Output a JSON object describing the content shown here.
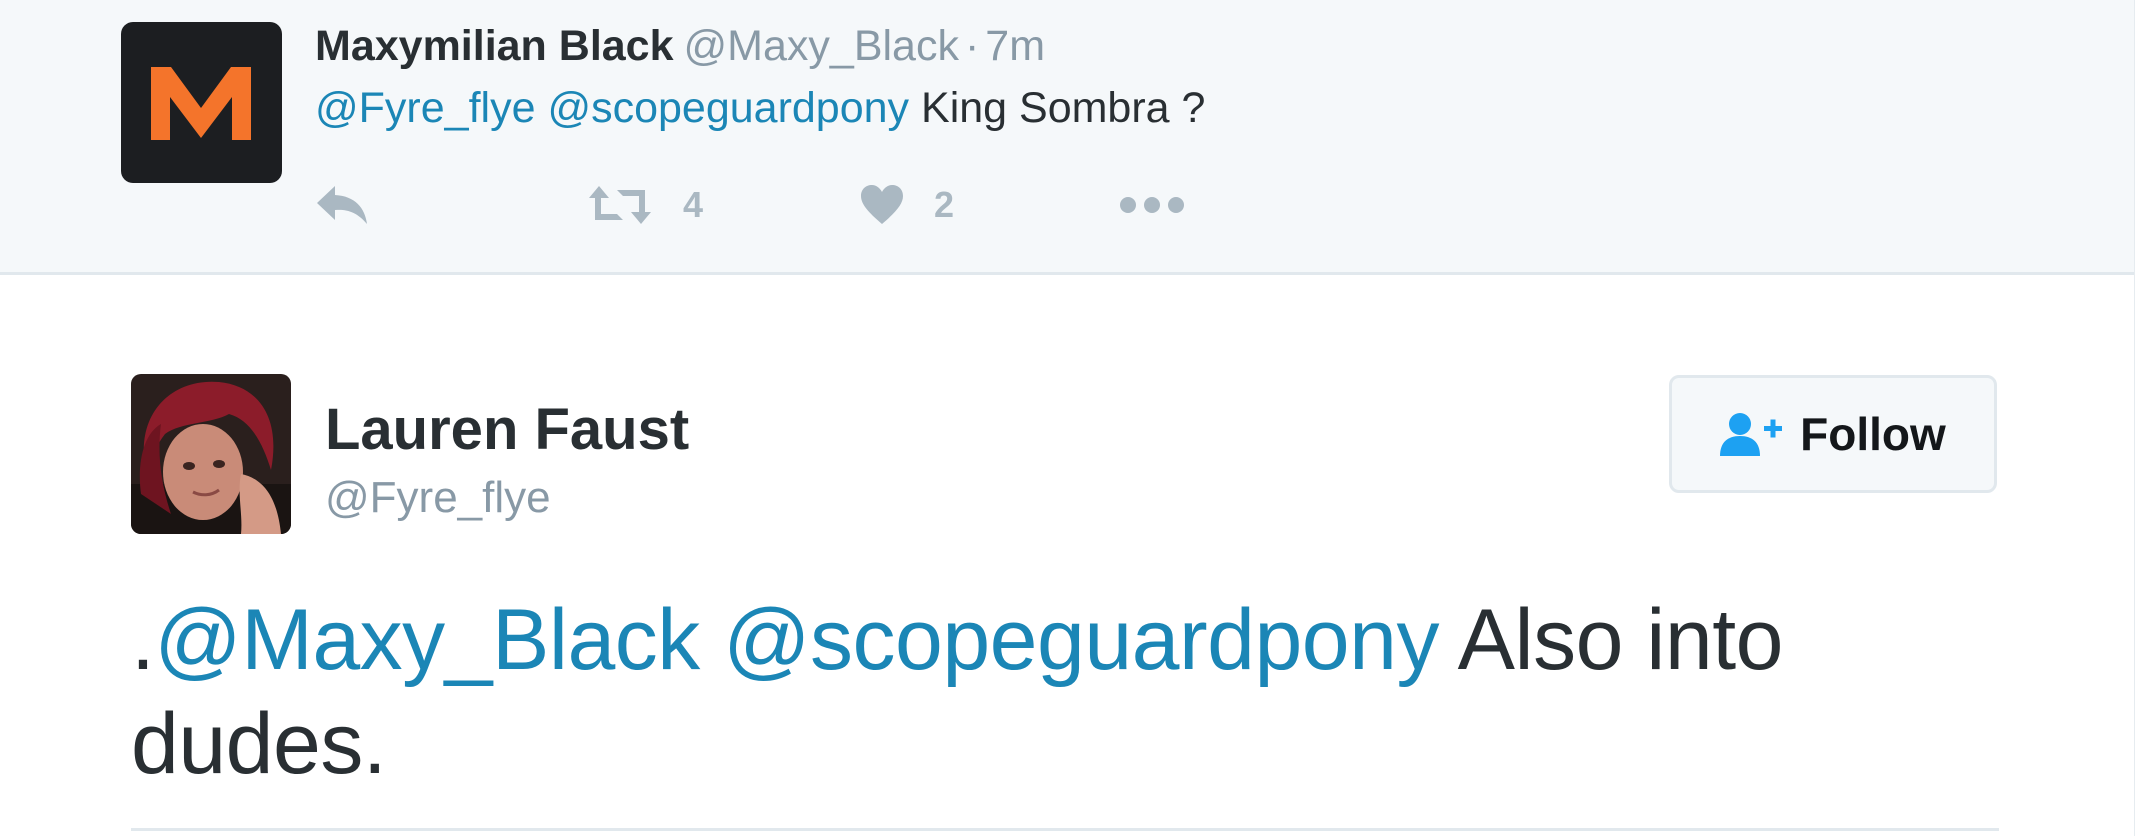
{
  "parent_tweet": {
    "avatar_letter": "M",
    "name": "Maxymilian Black",
    "handle": "@Maxy_Black",
    "separator": "·",
    "time": "7m",
    "text": [
      {
        "type": "mention",
        "value": "@Fyre_flye"
      },
      {
        "type": "text",
        "value": " "
      },
      {
        "type": "mention",
        "value": "@scopeguardpony"
      },
      {
        "type": "text",
        "value": " King Sombra ?"
      }
    ],
    "actions": {
      "reply_icon": "reply-icon",
      "retweet_icon": "retweet-icon",
      "retweet_count": "4",
      "like_icon": "heart-icon",
      "like_count": "2",
      "more_icon": "more-dots-icon"
    }
  },
  "main_tweet": {
    "name": "Lauren Faust",
    "handle": "@Fyre_flye",
    "follow_label": "Follow",
    "follow_icon": "add-user-icon",
    "text": [
      {
        "type": "text",
        "value": "."
      },
      {
        "type": "mention",
        "value": "@Maxy_Black"
      },
      {
        "type": "text",
        "value": " "
      },
      {
        "type": "mention",
        "value": "@scopeguardpony"
      },
      {
        "type": "text",
        "value": " Also into dudes."
      }
    ]
  },
  "colors": {
    "mention": "#1b86b6",
    "text": "#292f33",
    "muted": "#8899a6",
    "icon": "#aab8c2",
    "follow_icon": "#1da1f2",
    "brand_orange": "#f4742b",
    "parent_bg": "#f5f8fa"
  }
}
